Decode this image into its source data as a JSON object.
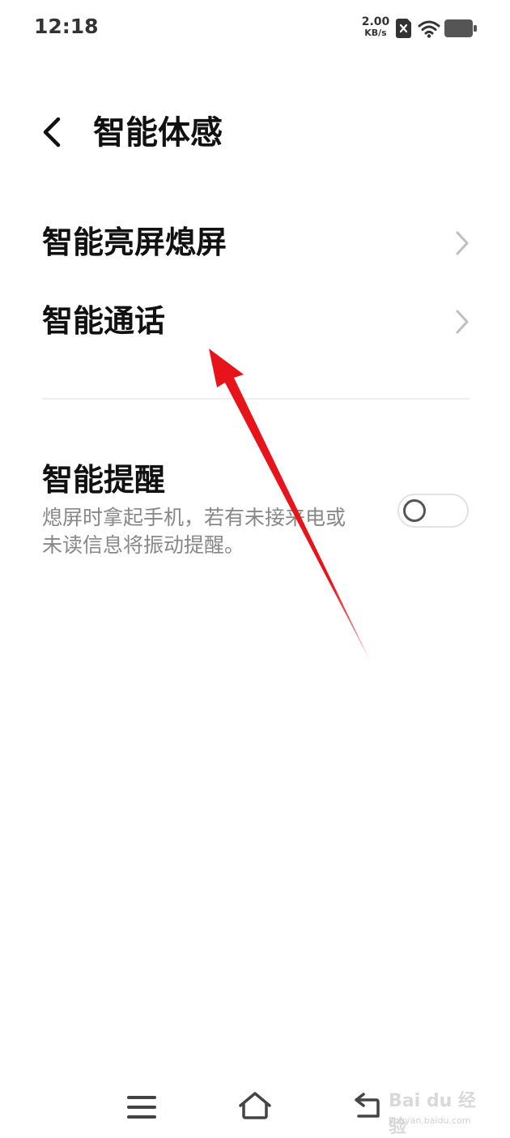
{
  "status_bar": {
    "time": "12:18",
    "net_speed_value": "2.00",
    "net_speed_unit": "KB/s",
    "icons": [
      "sim-icon",
      "wifi-icon",
      "battery-icon"
    ]
  },
  "header": {
    "back_icon": "chevron-left-icon",
    "title": "智能体感"
  },
  "settings": {
    "items": [
      {
        "label": "智能亮屏熄屏",
        "icon": "chevron-right-icon"
      },
      {
        "label": "智能通话",
        "icon": "chevron-right-icon"
      }
    ],
    "reminder": {
      "title": "智能提醒",
      "description": "熄屏时拿起手机，若有未接来电或未读信息将振动提醒。",
      "enabled": false
    }
  },
  "annotation": {
    "color": "#e8141b"
  },
  "nav_bar": {
    "icons": [
      "menu-icon",
      "home-icon",
      "back-icon"
    ]
  },
  "watermark": {
    "logo": "Bai du 经验",
    "sub": "jingyan.baidu.com"
  }
}
